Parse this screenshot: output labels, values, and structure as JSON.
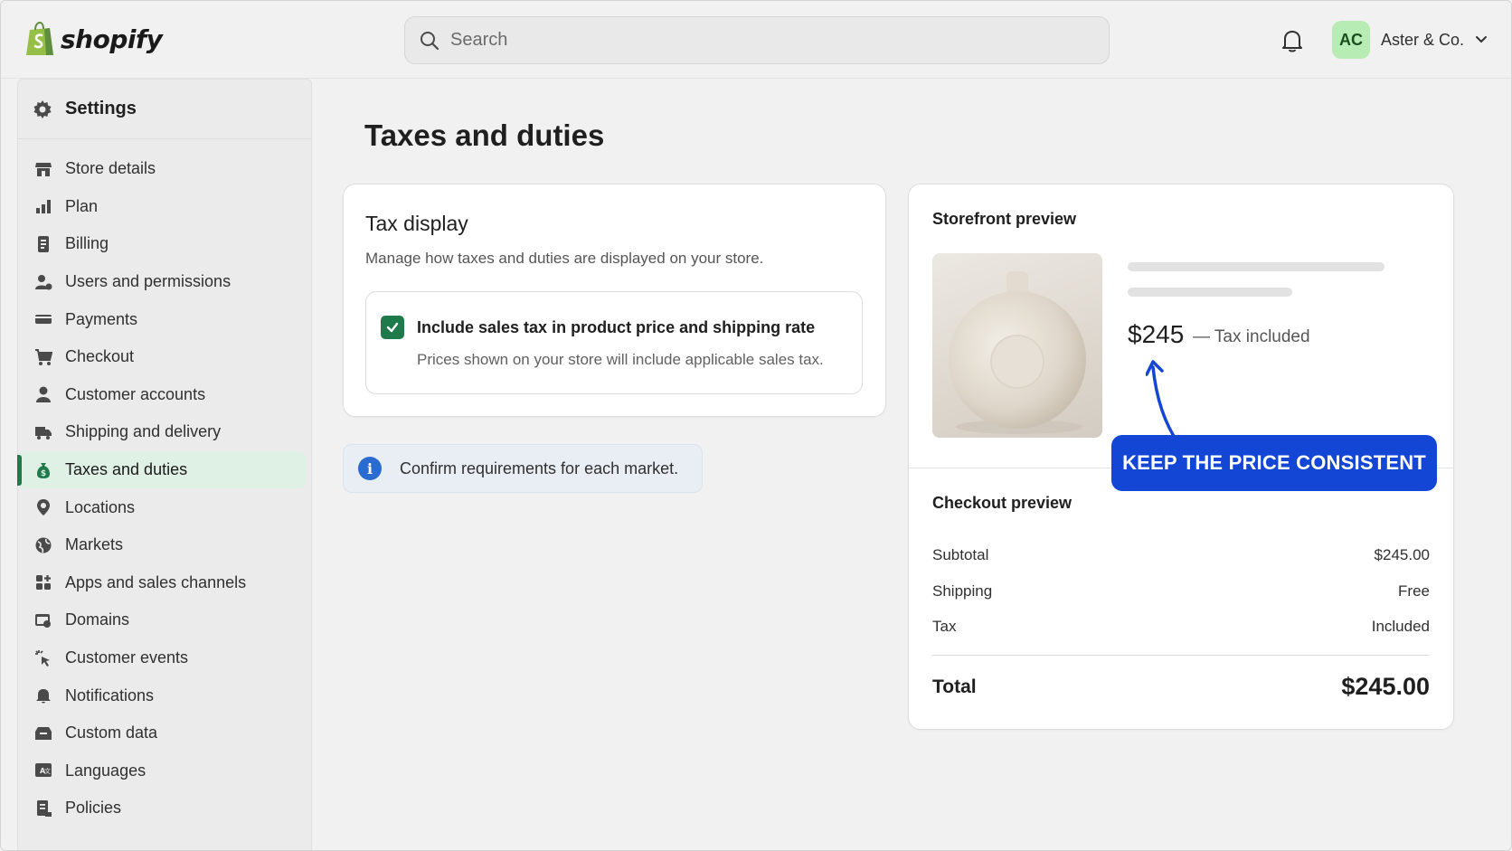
{
  "brand": {
    "name": "shopify",
    "accent": "#1e7a4a"
  },
  "search": {
    "placeholder": "Search"
  },
  "account": {
    "initials": "AC",
    "name": "Aster & Co."
  },
  "sidebar": {
    "title": "Settings",
    "items": [
      {
        "label": "Store details",
        "icon": "store-icon"
      },
      {
        "label": "Plan",
        "icon": "plan-icon"
      },
      {
        "label": "Billing",
        "icon": "billing-icon"
      },
      {
        "label": "Users and permissions",
        "icon": "users-icon"
      },
      {
        "label": "Payments",
        "icon": "payments-icon"
      },
      {
        "label": "Checkout",
        "icon": "cart-icon"
      },
      {
        "label": "Customer accounts",
        "icon": "person-icon"
      },
      {
        "label": "Shipping and delivery",
        "icon": "truck-icon"
      },
      {
        "label": "Taxes and duties",
        "icon": "tax-icon",
        "active": true
      },
      {
        "label": "Locations",
        "icon": "location-icon"
      },
      {
        "label": "Markets",
        "icon": "globe-icon"
      },
      {
        "label": "Apps and sales channels",
        "icon": "apps-icon"
      },
      {
        "label": "Domains",
        "icon": "domains-icon"
      },
      {
        "label": "Customer events",
        "icon": "cursor-click-icon"
      },
      {
        "label": "Notifications",
        "icon": "bell-icon"
      },
      {
        "label": "Custom data",
        "icon": "data-icon"
      },
      {
        "label": "Languages",
        "icon": "language-icon"
      },
      {
        "label": "Policies",
        "icon": "policy-icon"
      }
    ]
  },
  "main": {
    "title": "Taxes and duties",
    "tax_display": {
      "heading": "Tax display",
      "description": "Manage how taxes and duties are displayed on your store.",
      "option_label": "Include sales tax in product price and shipping rate",
      "option_help": "Prices shown on your store will include applicable sales tax.",
      "checked": true
    },
    "info_banner": "Confirm requirements for each market.",
    "storefront": {
      "title": "Storefront preview",
      "price": "$245",
      "price_note": "— Tax included",
      "callout": "KEEP THE PRICE CONSISTENT",
      "callout_color": "#1446d6"
    },
    "checkout": {
      "title": "Checkout preview",
      "subtotal_label": "Subtotal",
      "subtotal_value": "$245.00",
      "shipping_label": "Shipping",
      "shipping_value": "Free",
      "tax_label": "Tax",
      "tax_value": "Included",
      "total_label": "Total",
      "total_value": "$245.00"
    }
  }
}
